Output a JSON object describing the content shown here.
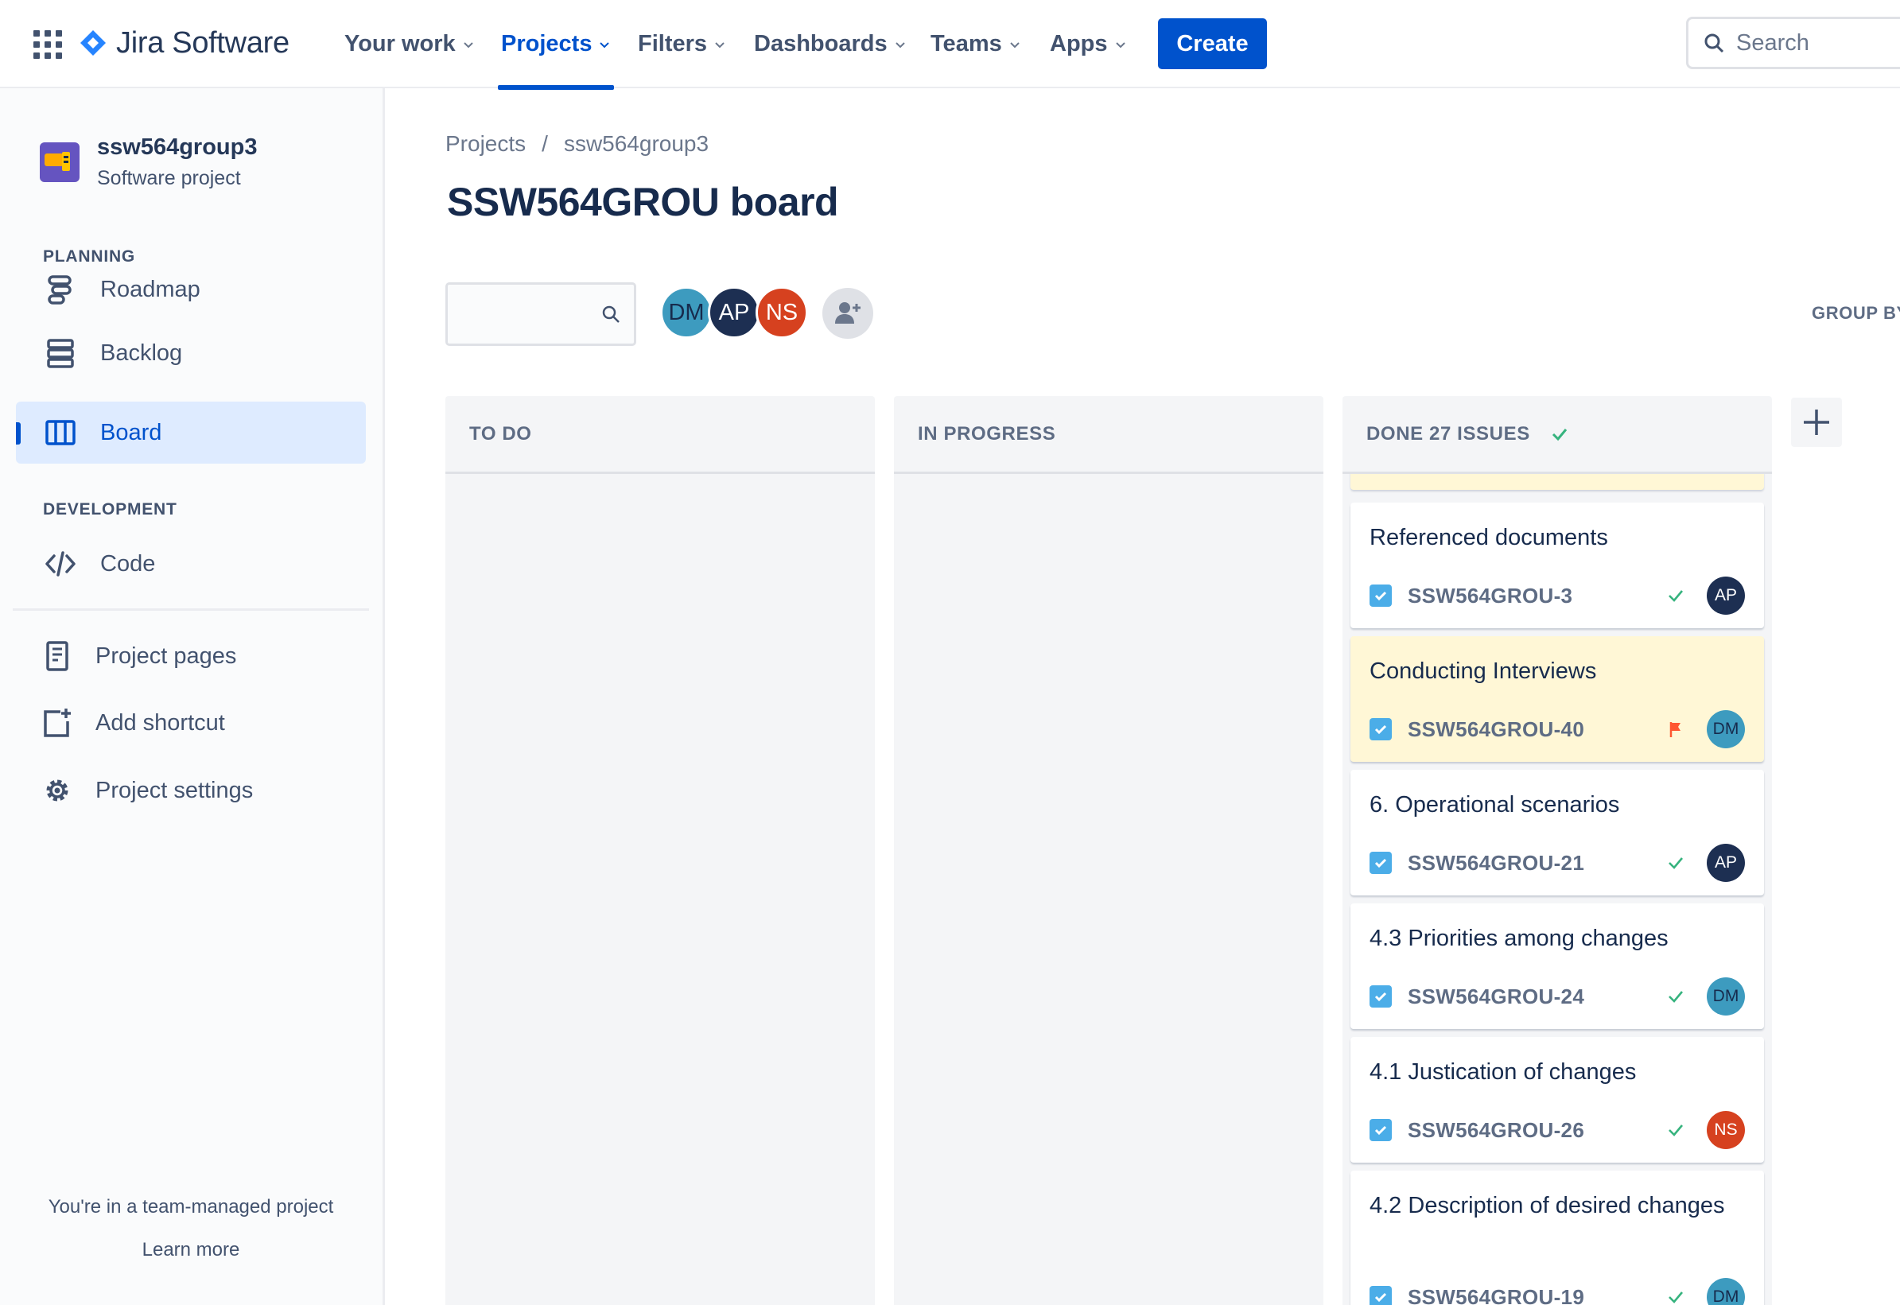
{
  "topnav": {
    "product_name": "Jira Software",
    "items": [
      {
        "label": "Your work"
      },
      {
        "label": "Projects"
      },
      {
        "label": "Filters"
      },
      {
        "label": "Dashboards"
      },
      {
        "label": "Teams"
      },
      {
        "label": "Apps"
      }
    ],
    "active_item": "Projects",
    "create_label": "Create",
    "search_placeholder": "Search"
  },
  "sidebar": {
    "project_name": "ssw564group3",
    "project_type": "Software project",
    "planning_title": "PLANNING",
    "planning_items": [
      {
        "label": "Roadmap",
        "icon": "roadmap-icon"
      },
      {
        "label": "Backlog",
        "icon": "backlog-icon"
      },
      {
        "label": "Board",
        "icon": "board-icon",
        "active": true
      }
    ],
    "development_title": "DEVELOPMENT",
    "development_items": [
      {
        "label": "Code",
        "icon": "code-icon"
      }
    ],
    "links": [
      {
        "label": "Project pages",
        "icon": "page-icon"
      },
      {
        "label": "Add shortcut",
        "icon": "add-shortcut-icon"
      },
      {
        "label": "Project settings",
        "icon": "gear-icon"
      }
    ],
    "footer_text": "You're in a team-managed project",
    "footer_link": "Learn more"
  },
  "main": {
    "breadcrumb": [
      "Projects",
      "ssw564group3"
    ],
    "breadcrumb_separator": "/",
    "title": "SSW564GROU board",
    "avatars": [
      "DM",
      "AP",
      "NS"
    ],
    "group_by_label": "GROUP BY",
    "columns": [
      {
        "title": "TO DO"
      },
      {
        "title": "IN PROGRESS"
      },
      {
        "title": "DONE 27 ISSUES"
      }
    ],
    "cards": [
      {
        "title": "Referenced documents",
        "key": "SSW564GROU-3",
        "status": "done",
        "assignee": "AP",
        "flagged": false
      },
      {
        "title": "Conducting Interviews",
        "key": "SSW564GROU-40",
        "status": "flag",
        "assignee": "DM",
        "flagged": true
      },
      {
        "title": "6. Operational scenarios",
        "key": "SSW564GROU-21",
        "status": "done",
        "assignee": "AP",
        "flagged": false
      },
      {
        "title": "4.3 Priorities among changes",
        "key": "SSW564GROU-24",
        "status": "done",
        "assignee": "DM",
        "flagged": false
      },
      {
        "title": "4.1 Justication of changes",
        "key": "SSW564GROU-26",
        "status": "done",
        "assignee": "NS",
        "flagged": false
      },
      {
        "title": "4.2 Description of desired changes",
        "key": "SSW564GROU-19",
        "status": "done",
        "assignee": "DM",
        "flagged": false
      }
    ]
  },
  "colors": {
    "brand_blue": "#0052cc",
    "flag_bg": "#fff7d6",
    "done_green": "#36b37e",
    "flag_red": "#ff5630"
  }
}
